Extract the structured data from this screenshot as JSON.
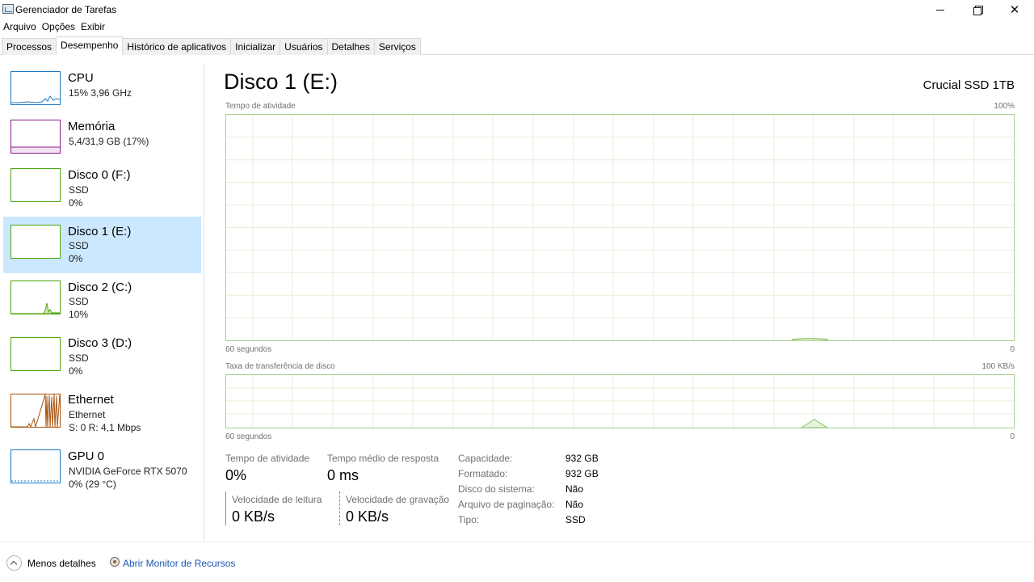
{
  "window": {
    "title": "Gerenciador de Tarefas",
    "icon": "task-manager-icon",
    "close_glyph": "✕"
  },
  "menu": [
    "Arquivo",
    "Opções",
    "Exibir"
  ],
  "tabs": [
    "Processos",
    "Desempenho",
    "Histórico de aplicativos",
    "Inicializar",
    "Usuários",
    "Detalhes",
    "Serviços"
  ],
  "active_tab": "Desempenho",
  "sidebar": {
    "items": [
      {
        "title": "CPU",
        "lines": [
          "15%  3,96 GHz"
        ],
        "color": "#1a79c4"
      },
      {
        "title": "Memória",
        "lines": [
          "5,4/31,9 GB (17%)"
        ],
        "color": "#8b1a8b"
      },
      {
        "title": "Disco 0 (F:)",
        "lines": [
          "SSD",
          "0%"
        ],
        "color": "#4da60c"
      },
      {
        "title": "Disco 1 (E:)",
        "lines": [
          "SSD",
          "0%"
        ],
        "color": "#4da60c",
        "selected": true
      },
      {
        "title": "Disco 2 (C:)",
        "lines": [
          "SSD",
          "10%"
        ],
        "color": "#4da60c"
      },
      {
        "title": "Disco 3 (D:)",
        "lines": [
          "SSD",
          "0%"
        ],
        "color": "#4da60c"
      },
      {
        "title": "Ethernet",
        "lines": [
          "Ethernet",
          "S: 0  R: 4,1 Mbps"
        ],
        "color": "#a7530e"
      },
      {
        "title": "GPU 0",
        "lines": [
          "NVIDIA GeForce RTX 5070",
          "0% (29 °C)"
        ],
        "color": "#1a79c4"
      }
    ]
  },
  "main": {
    "title": "Disco 1 (E:)",
    "model": "Crucial SSD 1TB",
    "accent_color": "#4da60c",
    "charts": {
      "activity": {
        "label": "Tempo de atividade",
        "max_label": "100%",
        "time_label": "60 segundos",
        "min_label": "0"
      },
      "transfer": {
        "label": "Taxa de transferência de disco",
        "max_label": "100 KB/s",
        "time_label": "60 segundos",
        "min_label": "0"
      }
    },
    "stats": {
      "active_time_label": "Tempo de atividade",
      "active_time_value": "0%",
      "avg_response_label": "Tempo médio de resposta",
      "avg_response_value": "0 ms",
      "read_speed_label": "Velocidade de leitura",
      "read_speed_value": "0 KB/s",
      "write_speed_label": "Velocidade de gravação",
      "write_speed_value": "0 KB/s"
    },
    "properties": [
      {
        "key": "Capacidade:",
        "value": "932 GB"
      },
      {
        "key": "Formatado:",
        "value": "932 GB"
      },
      {
        "key": "Disco do sistema:",
        "value": "Não"
      },
      {
        "key": "Arquivo de paginação:",
        "value": "Não"
      },
      {
        "key": "Tipo:",
        "value": "SSD"
      }
    ]
  },
  "footer": {
    "less_details": "Menos detalhes",
    "resource_monitor": "Abrir Monitor de Recursos"
  }
}
